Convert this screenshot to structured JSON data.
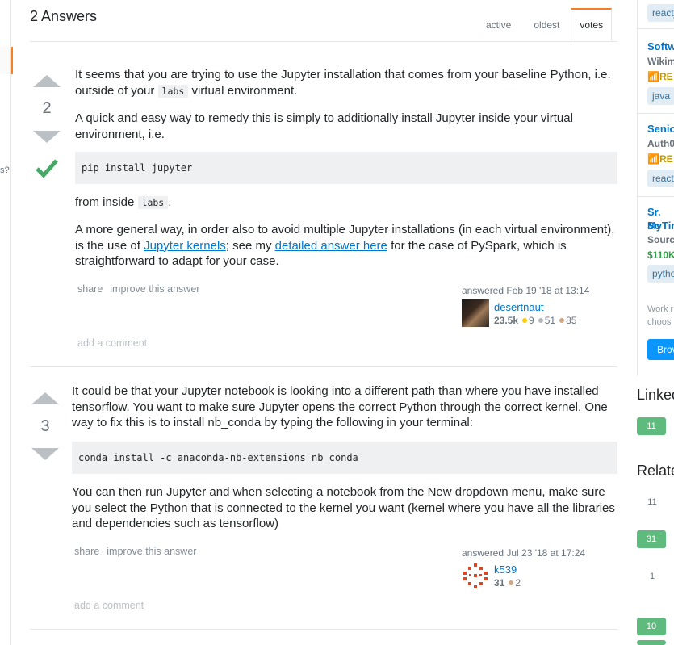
{
  "left_edge": {
    "fragment_text": "s?"
  },
  "header": {
    "answers_count_label": "2 Answers",
    "tabs": [
      {
        "label": "active"
      },
      {
        "label": "oldest"
      },
      {
        "label": "votes"
      }
    ]
  },
  "answer1": {
    "vote_count": "2",
    "accepted": true,
    "para1_a": "It seems that you are trying to use the Jupyter installation that comes from your baseline Python, i.e. outside of your",
    "para1_code": "labs",
    "para1_b": "virtual environment.",
    "para2": "A quick and easy way to remedy this is simply to additionally install Jupyter inside your virtual environment, i.e.",
    "code_block": "pip install jupyter",
    "para3_a": "from inside",
    "para3_code": "labs",
    "para3_b": ".",
    "para4_a": "A more general way, in order also to avoid multiple Jupyter installations (in each virtual environment), is the use of",
    "para4_link1": "Jupyter kernels",
    "para4_b": "; see my",
    "para4_link2": "detailed answer here",
    "para4_c": "for the case of PySpark, which is straightforward to adapt for your case.",
    "share_label": "share",
    "improve_label": "improve this answer",
    "answered_label": "answered Feb 19 '18 at 13:14",
    "user_name": "desertnaut",
    "reputation": "23.5k",
    "gold": "9",
    "silver": "51",
    "bronze": "85",
    "add_comment_label": "add a comment"
  },
  "answer2": {
    "vote_count": "3",
    "para1": "It could be that your Jupyter notebook is looking into a different path than where you have installed tensorflow. You want to make sure Jupyter opens the correct Python through the correct kernel. One way to fix this is to install nb_conda by typing the following in your terminal:",
    "code_block": "conda install -c anaconda-nb-extensions nb_conda",
    "para2": "You can then run Jupyter and when selecting a notebook from the New dropdown menu, make sure you select the Python that is connected to the kernel you want (kernel where you have all the libraries and dependencies such as tensorflow)",
    "share_label": "share",
    "improve_label": "improve this answer",
    "answered_label": "answered Jul 23 '18 at 17:24",
    "user_name": "k539",
    "reputation": "31",
    "bronze": "2",
    "add_comment_label": "add a comment"
  },
  "sidebar": {
    "tag_top": "reactj",
    "job1": {
      "title": "Softw",
      "company": "Wikim",
      "remote": "RE",
      "tag": "java"
    },
    "job2": {
      "title": "Senio",
      "company": "Auth0",
      "remote": "RE",
      "tag": "react"
    },
    "job3": {
      "title_line1": "Sr. Sc",
      "title_line2": "MyTin",
      "company": "Sourc",
      "salary": "$110K",
      "tag": "pytho"
    },
    "note_line1": "Work r",
    "note_line2": "choos",
    "browse_label": "Brov",
    "linked_heading": "Linked",
    "linked_badges": [
      "11"
    ],
    "related_heading": "Relate",
    "related_badges": [
      "11",
      "31",
      "1",
      "10"
    ]
  },
  "colors": {
    "accent_orange": "#f48024",
    "link_blue": "#0077cc",
    "accepted_green": "#48a868",
    "badge_green": "#5eba7d",
    "gold": "#ffcc01",
    "silver": "#b4b8bc",
    "bronze": "#d1a684"
  },
  "icons": [
    "vote-up-arrow-icon",
    "vote-down-arrow-icon",
    "accepted-check-icon",
    "wifi-icon"
  ]
}
